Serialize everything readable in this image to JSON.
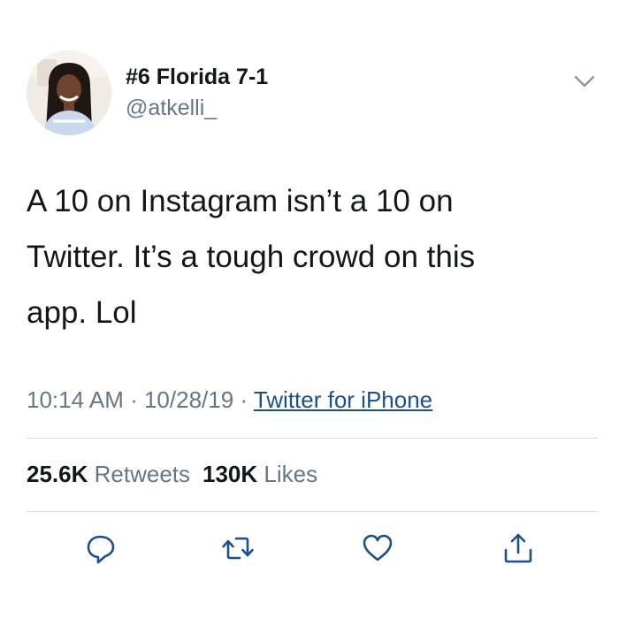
{
  "tweet": {
    "author": {
      "display_name": "#6 Florida 7-1",
      "handle": "@atkelli_"
    },
    "text_lines": [
      "A 10 on Instagram isn’t a 10 on",
      "Twitter.  It’s a tough crowd on this",
      "app. Lol"
    ],
    "meta": {
      "time": "10:14 AM",
      "sep1": " · ",
      "date": "10/28/19",
      "sep2": " · ",
      "source": "Twitter for iPhone"
    },
    "stats": {
      "retweets_count": "25.6K",
      "retweets_label": "Retweets",
      "likes_count": "130K",
      "likes_label": "Likes"
    },
    "icons": {
      "menu": "chevron-down-icon",
      "reply": "reply-icon",
      "retweet": "retweet-icon",
      "like": "heart-icon",
      "share": "share-icon"
    },
    "colors": {
      "text": "#14171a",
      "secondary": "#657786",
      "link": "#1c4f8c",
      "divider": "#d5dbe0",
      "icon": "#1c4f8c"
    }
  }
}
